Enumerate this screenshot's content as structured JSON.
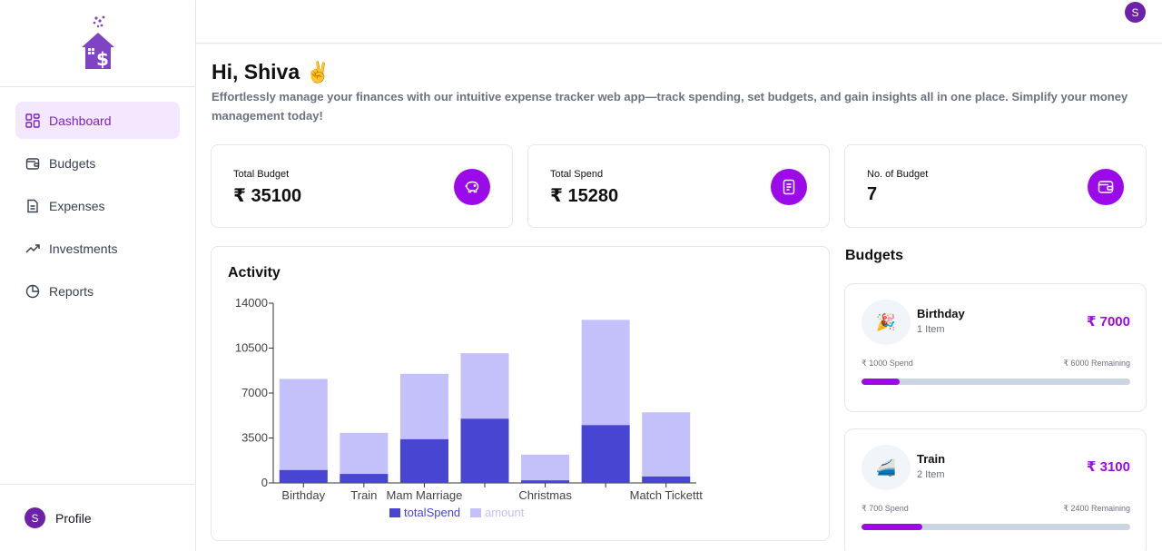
{
  "sidebar": {
    "items": [
      {
        "label": "Dashboard",
        "icon": "dashboard-grid-icon",
        "active": true
      },
      {
        "label": "Budgets",
        "icon": "wallet-icon",
        "active": false
      },
      {
        "label": "Expenses",
        "icon": "receipt-icon",
        "active": false
      },
      {
        "label": "Investments",
        "icon": "trending-up-icon",
        "active": false
      },
      {
        "label": "Reports",
        "icon": "pie-chart-icon",
        "active": false
      }
    ],
    "profile": {
      "label": "Profile",
      "avatar_initial": "S"
    }
  },
  "topbar": {
    "avatar_initial": "S"
  },
  "header": {
    "greeting": "Hi, Shiva",
    "wave": "✌️",
    "subtitle": "Effortlessly manage your finances with our intuitive expense tracker web app—track spending, set budgets, and gain insights all in one place. Simplify your money management today!"
  },
  "stats": [
    {
      "label": "Total Budget",
      "value": "₹ 35100",
      "icon": "piggy-bank-icon"
    },
    {
      "label": "Total Spend",
      "value": "₹ 15280",
      "icon": "receipt-icon"
    },
    {
      "label": "No. of Budget",
      "value": "7",
      "icon": "wallet-icon"
    }
  ],
  "activity": {
    "title": "Activity"
  },
  "chart_data": {
    "type": "bar",
    "stacked": false,
    "overlay": true,
    "categories": [
      "Birthday",
      "Train",
      "Mam Marriage",
      "",
      "Christmas",
      "",
      "Match Tickettt"
    ],
    "series": [
      {
        "name": "totalSpend",
        "color": "#4845d2",
        "values": [
          1000,
          700,
          3400,
          5000,
          200,
          4500,
          500
        ]
      },
      {
        "name": "amount",
        "color": "#c4c1fa",
        "values": [
          8100,
          3900,
          8500,
          10100,
          2200,
          12700,
          5500
        ]
      }
    ],
    "yticks": [
      0,
      3500,
      7000,
      10500,
      14000
    ],
    "ylim": [
      0,
      14000
    ],
    "legend": "bottom-center"
  },
  "budgets": {
    "title": "Budgets",
    "items": [
      {
        "icon": "🎉",
        "name": "Birthday",
        "items": "1 Item",
        "amount": "₹ 7000",
        "spend": "₹ 1000 Spend",
        "remaining": "₹ 6000 Remaining",
        "progress": 0.143
      },
      {
        "icon": "🚄",
        "name": "Train",
        "items": "2 Item",
        "amount": "₹ 3100",
        "spend": "₹ 700 Spend",
        "remaining": "₹ 2400 Remaining",
        "progress": 0.226
      }
    ]
  },
  "colors": {
    "accent": "#9b0ae8",
    "active_bg": "#f3e8ff",
    "spend_bar": "#4845d2",
    "amount_bar": "#c4c1fa"
  }
}
